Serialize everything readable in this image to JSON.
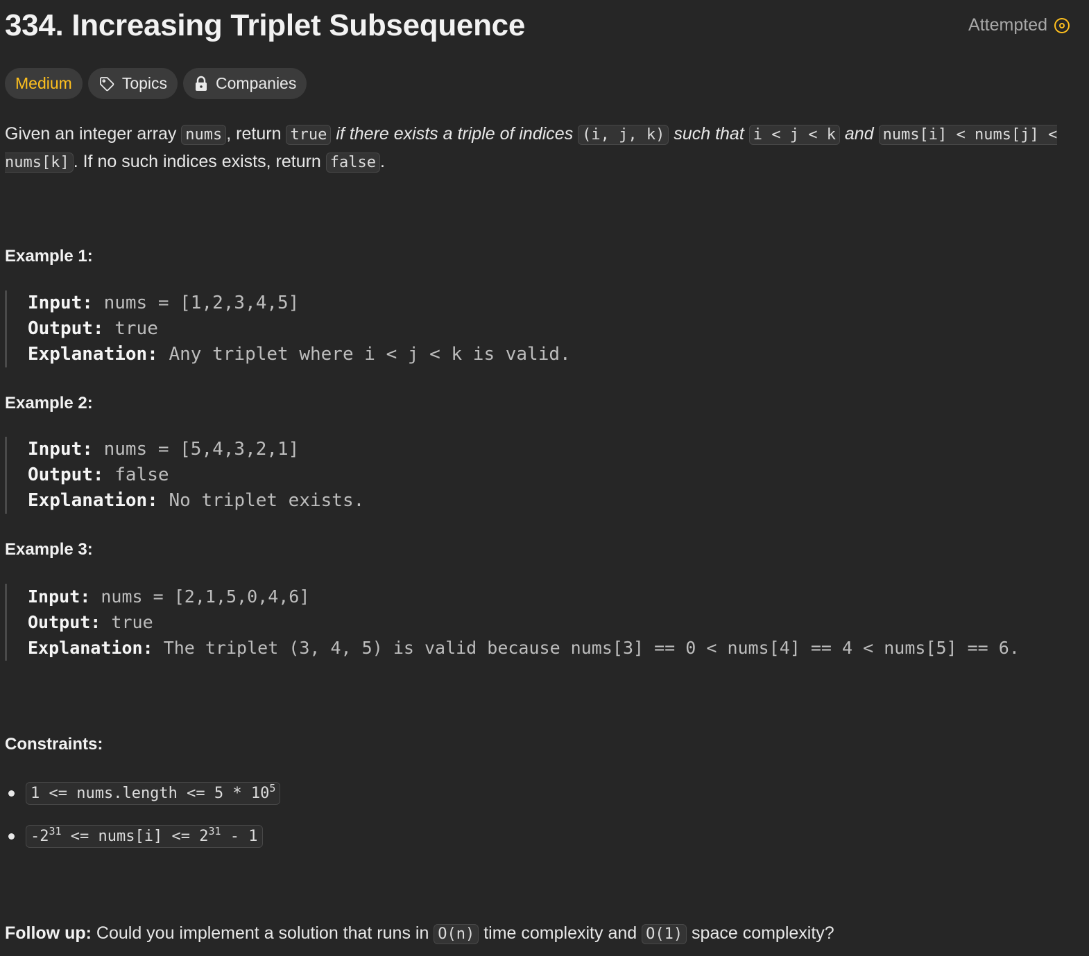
{
  "problem": {
    "title": "334. Increasing Triplet Subsequence",
    "status": "Attempted",
    "tags": {
      "difficulty": "Medium",
      "topics": "Topics",
      "companies": "Companies"
    },
    "description": {
      "t1": "Given an integer array ",
      "c1": "nums",
      "t2": ", return ",
      "c2": "true",
      "i1": "if there exists a triple of indices",
      "c3": "(i, j, k)",
      "i2": "such that",
      "c4": "i < j < k",
      "i3": "and",
      "c5": "nums[i] < nums[j] < nums[k]",
      "t3": ". If no such indices exists, return ",
      "c6": "false",
      "t4": "."
    },
    "examples": [
      {
        "heading": "Example 1:",
        "input_label": "Input:",
        "input": "nums = [1,2,3,4,5]",
        "output_label": "Output:",
        "output": "true",
        "explanation_label": "Explanation:",
        "explanation": "Any triplet where i < j < k is valid."
      },
      {
        "heading": "Example 2:",
        "input_label": "Input:",
        "input": "nums = [5,4,3,2,1]",
        "output_label": "Output:",
        "output": "false",
        "explanation_label": "Explanation:",
        "explanation": "No triplet exists."
      },
      {
        "heading": "Example 3:",
        "input_label": "Input:",
        "input": "nums = [2,1,5,0,4,6]",
        "output_label": "Output:",
        "output": "true",
        "explanation_label": "Explanation:",
        "explanation": "The triplet (3, 4, 5) is valid because nums[3] == 0 < nums[4] == 4 < nums[5] == 6."
      }
    ],
    "constraints": {
      "heading": "Constraints:",
      "c1_pre": "1 <= nums.length <= 5 * 10",
      "c1_sup": "5",
      "c2_a": "-2",
      "c2_sup1": "31",
      "c2_b": " <= nums[i] <= 2",
      "c2_sup2": "31",
      "c2_c": " - 1"
    },
    "followup": {
      "label": "Follow up:",
      "t1": " Could you implement a solution that runs in ",
      "c1": "O(n)",
      "t2": " time complexity and ",
      "c2": "O(1)",
      "t3": " space complexity?"
    }
  },
  "colors": {
    "background": "#262626",
    "medium": "#ffc01e",
    "attempted_icon": "#ffc01e"
  }
}
